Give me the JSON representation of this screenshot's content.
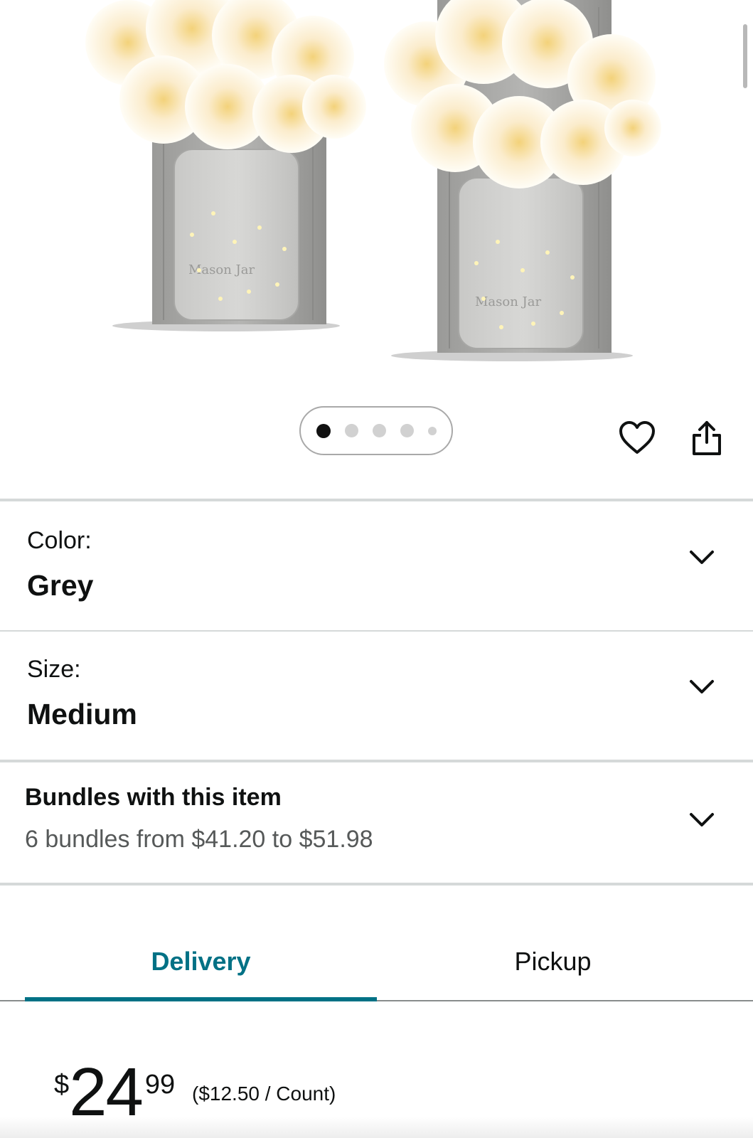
{
  "carousel": {
    "image_alt": "Grey wooden wall sconces with mason jars, fairy lights and cream hydrangea flowers",
    "jar_embossing": "Mason Jar",
    "dot_count": 5,
    "active_index": 0
  },
  "actions": {
    "wishlist_icon": "heart-icon",
    "share_icon": "share-icon"
  },
  "variations": {
    "color": {
      "label": "Color:",
      "value": "Grey"
    },
    "size": {
      "label": "Size:",
      "value": "Medium"
    }
  },
  "bundles": {
    "title": "Bundles with this item",
    "subtitle": "6 bundles from $41.20 to $51.98"
  },
  "tabs": [
    {
      "label": "Delivery",
      "selected": true
    },
    {
      "label": "Pickup",
      "selected": false
    }
  ],
  "price": {
    "symbol": "$",
    "whole": "24",
    "fraction": "99",
    "per_unit": "($12.50 / Count)"
  },
  "colors": {
    "accent": "#007185",
    "text": "#0f1111",
    "secondary_text": "#565959",
    "divider": "#d5d9d9"
  }
}
